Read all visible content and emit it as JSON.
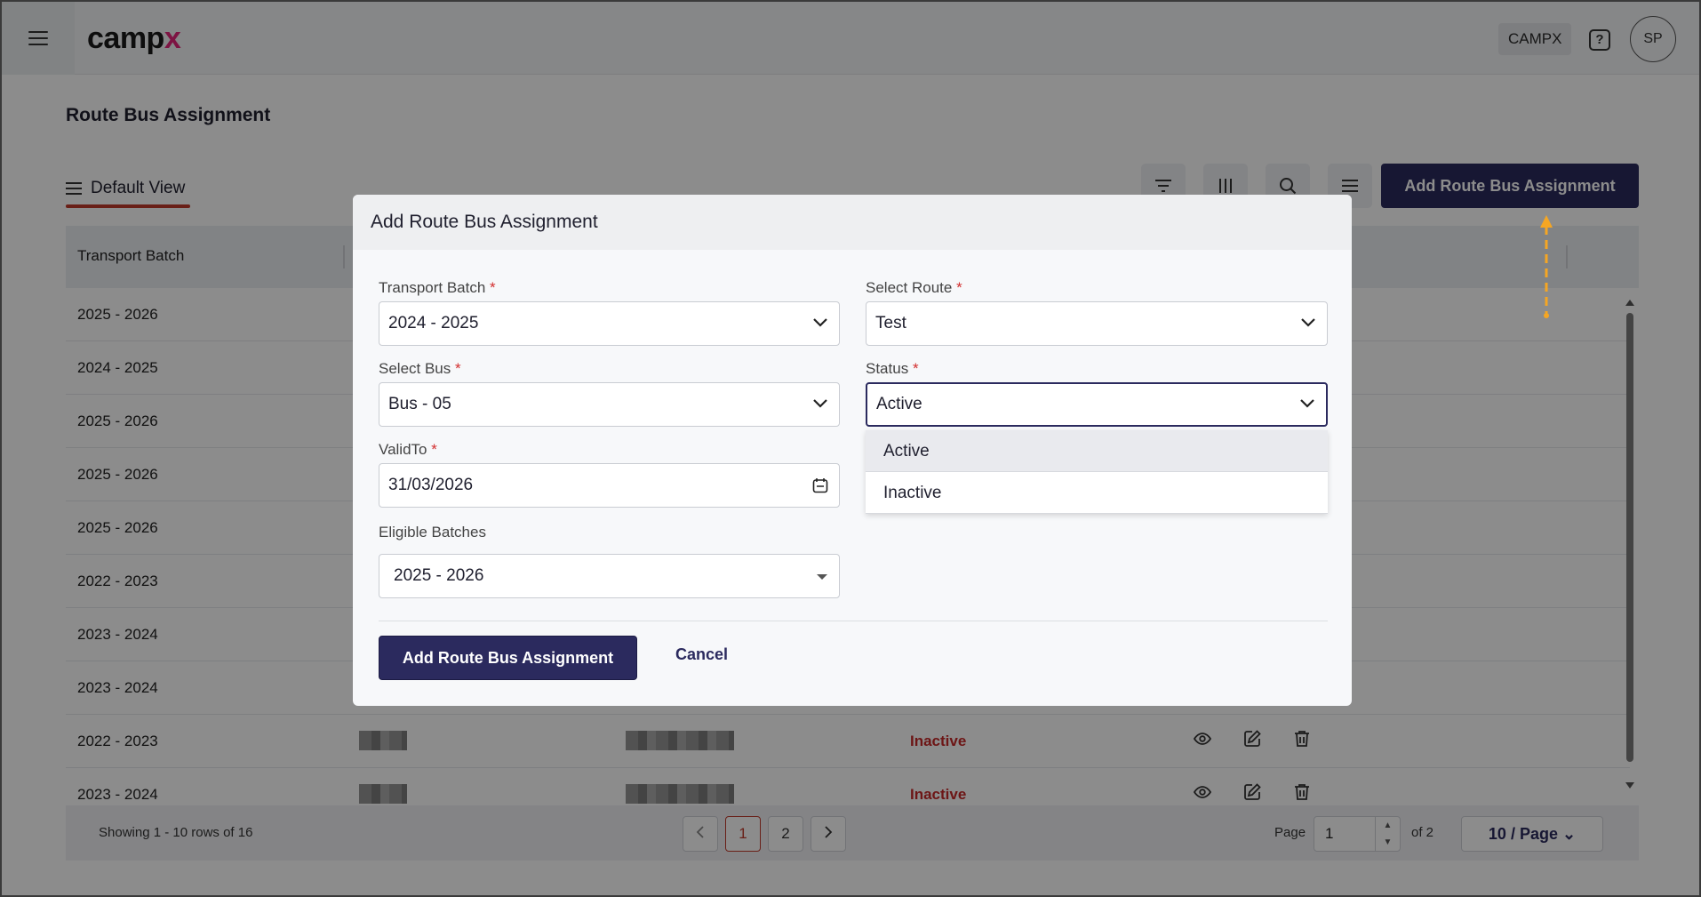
{
  "app": {
    "logo_text": "camp",
    "logo_accent": "x",
    "org": "CAMPX",
    "user_initials": "SP",
    "help_glyph": "?"
  },
  "page": {
    "title": "Route Bus Assignment",
    "view_name": "Default View",
    "add_button": "Add Route Bus Assignment"
  },
  "table": {
    "headers": [
      "Transport Batch"
    ],
    "rows": [
      {
        "batch": "2025 - 2026",
        "status": ""
      },
      {
        "batch": "2024 - 2025",
        "status": ""
      },
      {
        "batch": "2025 - 2026",
        "status": ""
      },
      {
        "batch": "2025 - 2026",
        "status": ""
      },
      {
        "batch": "2025 - 2026",
        "status": ""
      },
      {
        "batch": "2022 - 2023",
        "status": ""
      },
      {
        "batch": "2023 - 2024",
        "status": ""
      },
      {
        "batch": "2023 - 2024",
        "status": ""
      },
      {
        "batch": "2022 - 2023",
        "status": "Inactive"
      },
      {
        "batch": "2023 - 2024",
        "status": "Inactive"
      }
    ]
  },
  "pagination": {
    "showing": "Showing 1 - 10 rows of 16",
    "pages": [
      "1",
      "2"
    ],
    "page_label": "Page",
    "current_page": "1",
    "of_total": "of 2",
    "per_page": "10 / Page"
  },
  "modal": {
    "title": "Add Route Bus Assignment",
    "transport_batch": {
      "label": "Transport Batch",
      "value": "2024 - 2025"
    },
    "route": {
      "label": "Select Route",
      "value": "Test"
    },
    "bus": {
      "label": "Select Bus",
      "value": "Bus - 05"
    },
    "status": {
      "label": "Status",
      "value": "Active",
      "options": [
        "Active",
        "Inactive"
      ]
    },
    "valid_to": {
      "label": "ValidTo",
      "value": "31/03/2026"
    },
    "eligible_batches": {
      "label": "Eligible Batches",
      "value": "2025 - 2026"
    },
    "required_mark": "*",
    "submit": "Add Route Bus Assignment",
    "cancel": "Cancel"
  },
  "colors": {
    "primary": "#2b2a5e",
    "danger": "#c62828",
    "accent": "#e4267a",
    "hint_arrow": "#f5a623"
  }
}
